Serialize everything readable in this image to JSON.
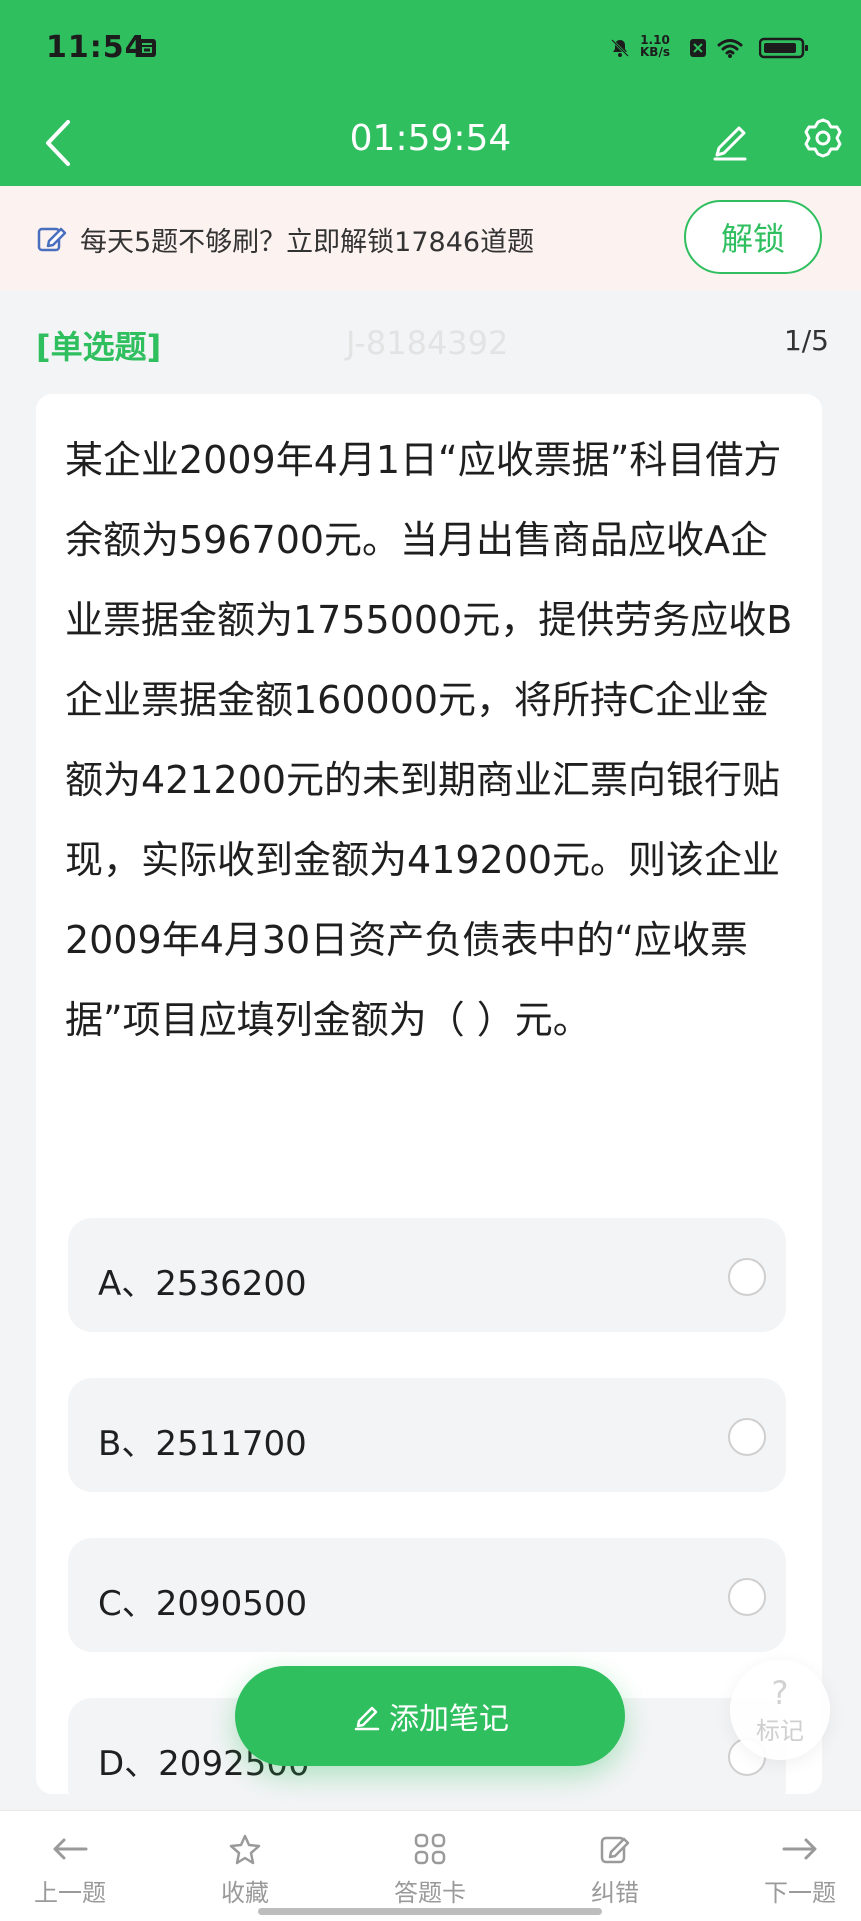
{
  "status_bar": {
    "time": "11:54",
    "speed_value": "1.10",
    "speed_unit": "KB/s"
  },
  "header": {
    "timer": "01:59:54"
  },
  "banner": {
    "text": "每天5题不够刷？立即解锁17846道题",
    "button": "解锁"
  },
  "question": {
    "type": "[单选题]",
    "watermark": "J-8184392",
    "progress": "1/5",
    "text": "某企业2009年4月1日“应收票据”科目借方余额为596700元。当月出售商品应收A企业票据金额为1755000元，提供劳务应收B企业票据金额160000元，将所持C企业金额为421200元的未到期商业汇票向银行贴现，实际收到金额为419200元。则该企业2009年4月30日资产负债表中的“应收票据”项目应填列金额为（ ）元。",
    "options": [
      "A、2536200",
      "B、2511700",
      "C、2090500",
      "D、2092500"
    ]
  },
  "floating": {
    "add_note": "添加笔记",
    "mark_symbol": "?",
    "mark_label": "标记"
  },
  "bottom_nav": {
    "items": [
      "上一题",
      "收藏",
      "答题卡",
      "纠错",
      "下一题"
    ]
  },
  "colors": {
    "primary": "#2fbf5f",
    "banner_bg": "#fcf3f0",
    "page_bg": "#f3f4f6",
    "text_dark": "#1f1f1f",
    "muted": "#9a9a9a"
  },
  "icons": {
    "nav_back": "back-arrow-icon",
    "nav_edit": "pencil-icon",
    "nav_settings": "gear-icon",
    "banner": "edit-note-icon",
    "bottom_prev": "left-arrow-icon",
    "bottom_favorite": "star-icon",
    "bottom_answer_card": "grid-icon",
    "bottom_error": "edit-icon",
    "bottom_next": "right-arrow-icon"
  }
}
